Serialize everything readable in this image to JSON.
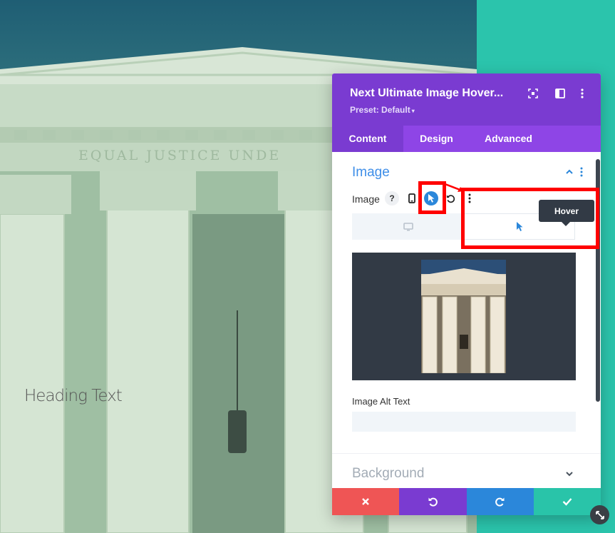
{
  "background": {
    "heading_text": "Heading Text"
  },
  "panel": {
    "title": "Next Ultimate Image Hover...",
    "preset": "Preset: Default",
    "tabs": [
      {
        "label": "Content",
        "active": true
      },
      {
        "label": "Design",
        "active": false
      },
      {
        "label": "Advanced",
        "active": false
      }
    ],
    "image_section": {
      "title": "Image",
      "field_label": "Image",
      "help_glyph": "?",
      "alt_label": "Image Alt Text",
      "alt_value": ""
    },
    "background_section": {
      "title": "Background"
    }
  },
  "tooltip": {
    "text": "Hover"
  },
  "colors": {
    "header_purple": "#7a3bd1",
    "tab_purple": "#8e45e6",
    "accent_blue": "#2b87da",
    "cancel_red": "#ef5555",
    "save_green": "#29c4a9",
    "teal_strip": "#2bc4ac",
    "highlight_red": "#ff0000"
  },
  "icons": {
    "header": [
      "focus-icon",
      "split-view-icon",
      "more-vertical-icon"
    ],
    "field": [
      "help-icon",
      "phone-icon",
      "hover-cursor-icon",
      "reset-icon",
      "more-vertical-icon"
    ],
    "footer": [
      "close-icon",
      "undo-icon",
      "redo-icon",
      "check-icon"
    ]
  }
}
